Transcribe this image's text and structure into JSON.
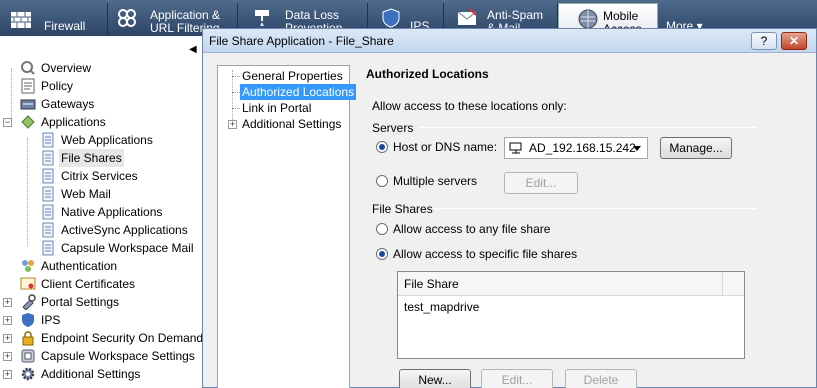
{
  "top_tabs": [
    {
      "label": "Firewall",
      "icon": "firewall-icon"
    },
    {
      "label": "Application &\nURL Filtering",
      "icon": "application-filtering-icon"
    },
    {
      "label": "Data Loss\nPrevention",
      "icon": "data-loss-prevention-icon"
    },
    {
      "label": "IPS",
      "icon": "ips-icon"
    },
    {
      "label": "Anti-Spam\n& Mail",
      "icon": "anti-spam-icon"
    },
    {
      "label": "Mobile\nAccess",
      "icon": "mobile-access-icon"
    },
    {
      "label": "More ▾",
      "icon": ""
    }
  ],
  "left_tree": {
    "items": [
      {
        "label": "Overview",
        "icon": "overview-icon"
      },
      {
        "label": "Policy",
        "icon": "policy-icon"
      },
      {
        "label": "Gateways",
        "icon": "gateways-icon"
      },
      {
        "label": "Applications",
        "icon": "applications-icon"
      },
      {
        "label": "Web Applications",
        "icon": "document-icon"
      },
      {
        "label": "File Shares",
        "icon": "document-icon"
      },
      {
        "label": "Citrix Services",
        "icon": "document-icon"
      },
      {
        "label": "Web Mail",
        "icon": "document-icon"
      },
      {
        "label": "Native Applications",
        "icon": "document-icon"
      },
      {
        "label": "ActiveSync Applications",
        "icon": "document-icon"
      },
      {
        "label": "Capsule Workspace Mail",
        "icon": "document-icon"
      },
      {
        "label": "Authentication",
        "icon": "authentication-icon"
      },
      {
        "label": "Client Certificates",
        "icon": "certificate-icon"
      },
      {
        "label": "Portal Settings",
        "icon": "portal-settings-icon"
      },
      {
        "label": "IPS",
        "icon": "ips-shield-icon"
      },
      {
        "label": "Endpoint Security On Demand",
        "icon": "lock-icon"
      },
      {
        "label": "Capsule Workspace Settings",
        "icon": "capsule-icon"
      },
      {
        "label": "Additional Settings",
        "icon": "gear-icon"
      }
    ]
  },
  "dialog": {
    "title": "File Share Application - File_Share",
    "help_label": "?",
    "close_label": "✕",
    "nav": [
      {
        "label": "General Properties"
      },
      {
        "label": "Authorized Locations"
      },
      {
        "label": "Link in Portal"
      },
      {
        "label": "Additional Settings"
      }
    ],
    "page_title": "Authorized Locations",
    "intro": "Allow access to these locations only:",
    "servers": {
      "group_label": "Servers",
      "host_label": "Host or DNS name:",
      "host_value": "AD_192.168.15.242",
      "manage_label": "Manage...",
      "multiple_label": "Multiple servers",
      "edit_label": "Edit..."
    },
    "file_shares": {
      "group_label": "File Shares",
      "any_label": "Allow access to any file share",
      "specific_label": "Allow access to specific file shares",
      "column_header": "File Share",
      "rows": [
        "test_mapdrive"
      ],
      "new_label": "New...",
      "edit_label": "Edit...",
      "delete_label": "Delete"
    }
  }
}
